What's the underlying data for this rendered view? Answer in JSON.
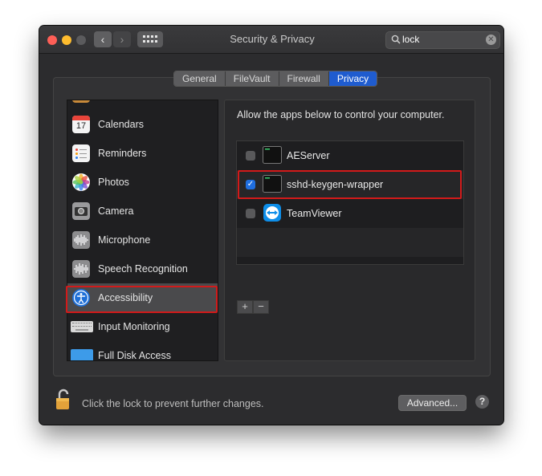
{
  "window": {
    "title": "Security & Privacy"
  },
  "search": {
    "value": "lock"
  },
  "tabs": [
    {
      "label": "General"
    },
    {
      "label": "FileVault"
    },
    {
      "label": "Firewall"
    },
    {
      "label": "Privacy",
      "active": true
    }
  ],
  "sidebar": {
    "items": [
      {
        "label": "Calendars",
        "icon": "calendar-icon",
        "badge": "17"
      },
      {
        "label": "Reminders",
        "icon": "reminders-icon"
      },
      {
        "label": "Photos",
        "icon": "photos-icon"
      },
      {
        "label": "Camera",
        "icon": "camera-icon"
      },
      {
        "label": "Microphone",
        "icon": "microphone-icon"
      },
      {
        "label": "Speech Recognition",
        "icon": "speech-recognition-icon"
      },
      {
        "label": "Accessibility",
        "icon": "accessibility-icon",
        "selected": true
      },
      {
        "label": "Input Monitoring",
        "icon": "keyboard-icon"
      },
      {
        "label": "Full Disk Access",
        "icon": "folder-icon"
      }
    ]
  },
  "main": {
    "description": "Allow the apps below to control your computer.",
    "apps": [
      {
        "name": "AEServer",
        "checked": false,
        "icon": "terminal-icon"
      },
      {
        "name": "sshd-keygen-wrapper",
        "checked": true,
        "icon": "terminal-icon"
      },
      {
        "name": "TeamViewer",
        "checked": false,
        "icon": "teamviewer-icon"
      }
    ],
    "add_label": "+",
    "remove_label": "−"
  },
  "footer": {
    "lock_text": "Click the lock to prevent further changes.",
    "advanced_label": "Advanced...",
    "help_label": "?"
  },
  "colors": {
    "accent": "#1f5ccf",
    "highlight_box": "#d21a1a",
    "checkbox_checked": "#1f6ee0"
  }
}
